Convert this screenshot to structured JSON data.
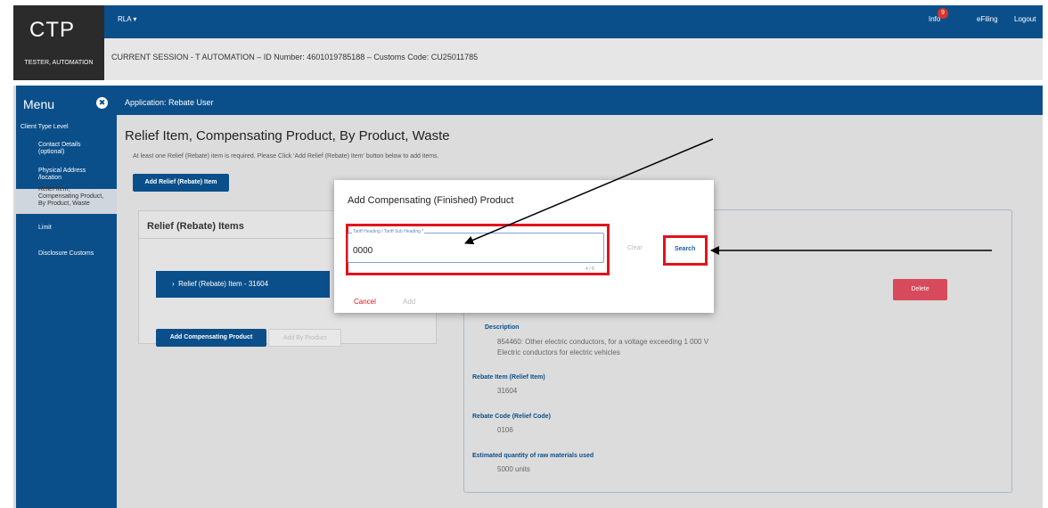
{
  "header": {
    "app_name": "CTP",
    "username": "TESTER, AUTOMATION",
    "role_selector": "RLA",
    "session": "CURRENT SESSION - T AUTOMATION – ID Number: 4601019785188 – Customs Code: CU25011785",
    "info_label": "Info",
    "info_badge": "9",
    "efiling_label": "eFiling",
    "logout_label": "Logout"
  },
  "sidebar": {
    "title": "Menu",
    "items": [
      {
        "label": "Client Type Level"
      },
      {
        "label": "Contact Details (optional)"
      },
      {
        "label": "Physical Address /location"
      },
      {
        "label": "Relief Item, Compensating Product, By Product, Waste"
      },
      {
        "label": "Limit"
      },
      {
        "label": "Disclosure Customs"
      }
    ]
  },
  "main": {
    "application": "Application: Rebate User",
    "page_title": "Relief Item, Compensating Product, By Product, Waste",
    "instruction": "At least one Relief (Rebate) item is required. Please Click 'Add Relief (Rebate) Item' button below to add items.",
    "add_relief_button": "Add Relief (Rebate) Item",
    "relief_panel_title": "Relief (Rebate) Items",
    "relief_item": "Relief (Rebate) Item - 31604",
    "add_comp_button": "Add Compensating Product",
    "add_by_button": "Add By Product",
    "delete_button": "Delete",
    "details": {
      "description_label": "Description",
      "description_line1": "854460: Other electric conductors, for a voltage exceeding 1 000 V",
      "description_line2": "Electric conductors for electric vehicles",
      "rebate_item_label": "Rebate Item (Relief Item)",
      "rebate_item_value": "31604",
      "rebate_code_label": "Rebate Code (Relief Code)",
      "rebate_code_value": "0106",
      "quantity_label": "Estimated quantity of raw materials used",
      "quantity_value": "5000 units"
    }
  },
  "modal": {
    "title": "Add Compensating (Finished) Product",
    "field_label": "Tariff Heading / Tariff Sub Heading *",
    "field_value": "0000",
    "char_count": "4 / 8",
    "clear_label": "Clear",
    "search_label": "Search",
    "cancel_label": "Cancel",
    "add_label": "Add"
  },
  "colors": {
    "brand_blue": "#0b4f8a",
    "highlight_red": "#e0141c",
    "delete_red": "#d64a5b"
  }
}
